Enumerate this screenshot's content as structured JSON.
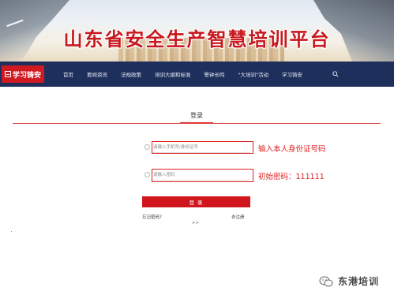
{
  "banner": {
    "title": "山东省安全生产智慧培训平台"
  },
  "nav": {
    "logo_label": "学习铸安",
    "items": [
      "首页",
      "要闻资讯",
      "法规政策",
      "培训大纲和标准",
      "警钟长鸣",
      "\"大培训\"活动",
      "学习铸安"
    ],
    "search_icon": "search-icon"
  },
  "login": {
    "tab_label": "登录",
    "id_field": {
      "placeholder": "请输入手机号/身份证号",
      "value": ""
    },
    "password_field": {
      "placeholder": "请输入密码",
      "value": ""
    },
    "submit_label": "登 录",
    "forgot_label": "忘记密码？",
    "register_label": "去注册",
    "more_label": ">>"
  },
  "annotations": {
    "id_hint": "输入本人身份证号码",
    "password_hint": "初始密码：111111"
  },
  "watermark": {
    "text": "东港培训"
  },
  "colors": {
    "brand_red": "#d0161c",
    "nav_bg": "#1f2f5c",
    "annotation_red": "#e02020"
  }
}
